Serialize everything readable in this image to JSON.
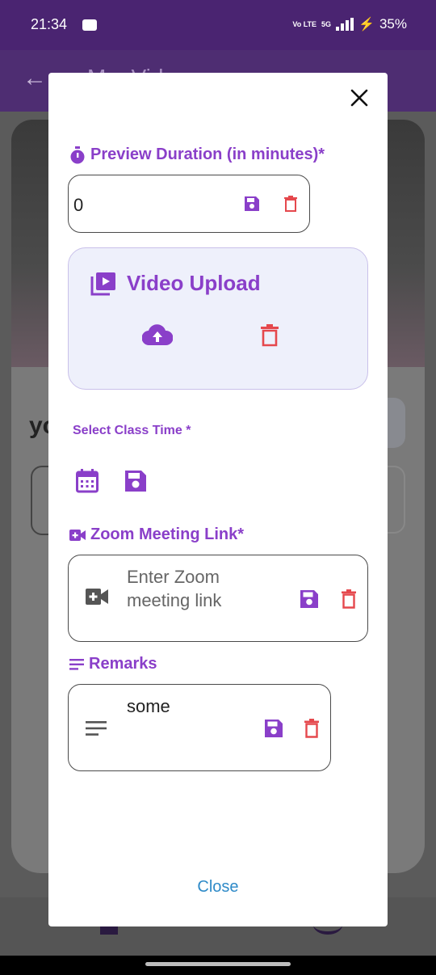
{
  "status_bar": {
    "time": "21:34",
    "network": "5G",
    "network_sub": "Vo LTE",
    "battery": "35%"
  },
  "background": {
    "appbar_title": "M... Vid...",
    "heading": "yo"
  },
  "dialog": {
    "preview_duration": {
      "label": "Preview Duration (in minutes)*",
      "value": "0"
    },
    "video_upload": {
      "title": "Video Upload"
    },
    "class_time": {
      "label": "Select Class Time *"
    },
    "zoom": {
      "label": "Zoom Meeting Link*",
      "placeholder": "Enter Zoom meeting link"
    },
    "remarks": {
      "label": "Remarks",
      "value": "some"
    },
    "close_label": "Close"
  },
  "colors": {
    "accent": "#8a3fc9",
    "delete": "#e5484d",
    "link": "#2e8ac8",
    "status_bar": "#4a2471"
  },
  "icons": [
    "close-icon",
    "timer-icon",
    "save-icon",
    "delete-icon",
    "video-library-icon",
    "cloud-upload-icon",
    "calendar-icon",
    "video-camera-icon",
    "notes-icon"
  ]
}
